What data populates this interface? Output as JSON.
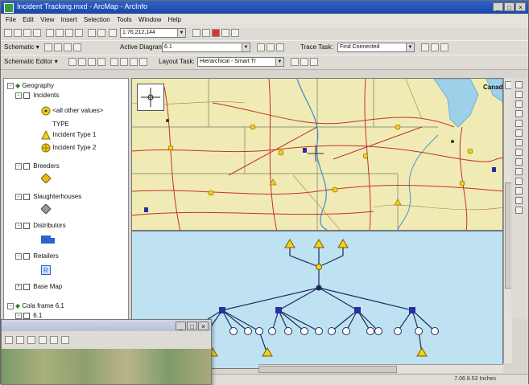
{
  "window": {
    "title": "Incident Tracking.mxd - ArcMap - ArcInfo",
    "minimize": "_",
    "maximize": "□",
    "close": "×"
  },
  "menu": [
    "File",
    "Edit",
    "View",
    "Insert",
    "Selection",
    "Tools",
    "Window",
    "Help"
  ],
  "toolbar1": {
    "scale_value": "1:76,212,144"
  },
  "toolbar2": {
    "schematic_label": "Schematic ▾",
    "active_diagram_label": "Active Diagram:",
    "active_diagram_value": "6.1",
    "trace_task_label": "Trace Task:",
    "trace_task_value": "Find Connected"
  },
  "toolbar3": {
    "schematic_editor_label": "Schematic Editor ▾",
    "layout_task_label": "Layout Task:",
    "layout_task_value": "Hierarchical - Smart Tr"
  },
  "toc": {
    "root": "Geography",
    "incidents": "Incidents",
    "all_other": "<all other values>",
    "type_label": "TYPE",
    "type1": "Incident Type 1",
    "type2": "Incident Type 2",
    "breeders": "Breeders",
    "slaughterhouses": "Slaughterhouses",
    "distributors": "Distributors",
    "retailers": "Retailers",
    "base_map": "Base Map",
    "cola_frame": "Cola frame 6.1",
    "cola_sub": "6.1"
  },
  "map": {
    "place_label": "Canada"
  },
  "status": {
    "coords": "7.06 8.53 Inches"
  },
  "subwindow": {
    "min": "_",
    "max": "□",
    "close": "×"
  },
  "colors": {
    "map_land": "#f0ebb4",
    "water": "#bfe2f2",
    "node_blue": "#2b2f9e",
    "node_yellow": "#f2d21a"
  }
}
